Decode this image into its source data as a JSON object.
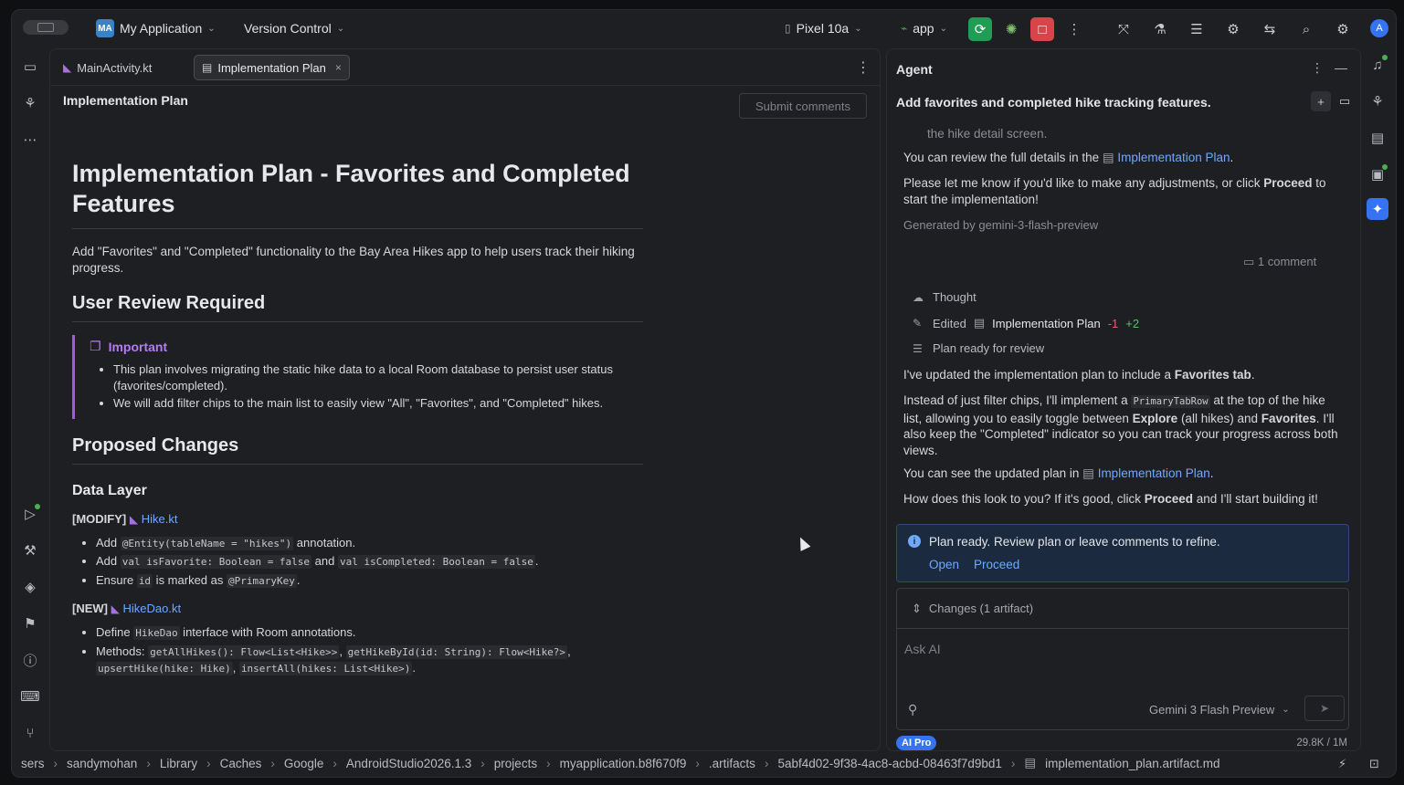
{
  "titlebar": {
    "project_badge": "MA",
    "project_name": "My Application",
    "vcs": "Version Control",
    "device": "Pixel 10a",
    "run_config": "app"
  },
  "avatar_letter": "A",
  "editor": {
    "tabs": [
      {
        "label": "MainActivity.kt"
      },
      {
        "label": "Implementation Plan"
      }
    ],
    "header": "Implementation Plan",
    "submit_label": "Submit comments",
    "doc": {
      "h1": "Implementation Plan - Favorites and Completed Features",
      "intro": "Add \"Favorites\" and \"Completed\" functionality to the Bay Area Hikes app to help users track their hiking progress.",
      "h2_review": "User Review Required",
      "callout_title": "Important",
      "callout_items": [
        "This plan involves migrating the static hike data to a local Room database to persist user status (favorites/completed).",
        "We will add filter chips to the main list to easily view \"All\", \"Favorites\", and \"Completed\" hikes."
      ],
      "h2_changes": "Proposed Changes",
      "h3_data": "Data Layer",
      "modify_tag": "[MODIFY]",
      "modify_file": "Hike.kt",
      "modify_items": {
        "add1_pre": "Add ",
        "add1_code": "@Entity(tableName = \"hikes\")",
        "add1_post": " annotation.",
        "add2_pre": "Add ",
        "add2_code1": "val isFavorite: Boolean = false",
        "add2_mid": " and ",
        "add2_code2": "val isCompleted: Boolean = false",
        "add2_post": ".",
        "ensure_pre": "Ensure ",
        "ensure_code1": "id",
        "ensure_mid": " is marked as ",
        "ensure_code2": "@PrimaryKey",
        "ensure_post": "."
      },
      "new_tag": "[NEW]",
      "new_file": "HikeDao.kt",
      "new_items": {
        "define_pre": "Define ",
        "define_code": "HikeDao",
        "define_post": " interface with Room annotations.",
        "methods_pre": "Methods: ",
        "m1": "getAllHikes(): Flow<List<Hike>>",
        "m2": "getHikeById(id: String): Flow<Hike?>",
        "m3": "upsertHike(hike: Hike)",
        "m4": "insertAll(hikes: List<Hike>)",
        "comma": ", ",
        "period": "."
      }
    }
  },
  "agent": {
    "title": "Agent",
    "subtitle": "Add favorites and completed hike tracking features.",
    "cut_line": "the hike detail screen.",
    "review_pre": "You can review the full details in the ",
    "review_link": "Implementation Plan",
    "review_post": ".",
    "proceed_pre": "Please let me know if you'd like to make any adjustments, or click ",
    "proceed_bold": "Proceed",
    "proceed_post": " to start the implementation!",
    "generated": "Generated by gemini-3-flash-preview",
    "comments": "1 comment",
    "thought": "Thought",
    "edited": "Edited",
    "edited_file": "Implementation Plan",
    "edited_minus": "-1",
    "edited_plus": "+2",
    "plan_ready_row": "Plan ready for review",
    "updated_pre": "I've updated the implementation plan to include a ",
    "updated_bold": "Favorites tab",
    "updated_post": ".",
    "instead_pre": "Instead of just filter chips, I'll implement a ",
    "instead_code": "PrimaryTabRow",
    "instead_mid": " at the top of the hike list, allowing you to easily toggle between ",
    "instead_b1": "Explore",
    "instead_mid2": " (all hikes) and ",
    "instead_b2": "Favorites",
    "instead_post": ". I'll also keep the \"Completed\" indicator so you can track your progress across both views.",
    "see_pre": "You can see the updated plan in ",
    "see_link": "Implementation Plan",
    "see_post": ".",
    "how_pre": "How does this look to you? If it's good, click ",
    "how_bold": "Proceed",
    "how_post": " and I'll start building it!",
    "plan_box_msg": "Plan ready. Review plan or leave comments to refine.",
    "plan_box_open": "Open",
    "plan_box_proceed": "Proceed",
    "changes": "Changes (1 artifact)",
    "ask_placeholder": "Ask AI",
    "model": "Gemini 3 Flash Preview",
    "badge": "AI Pro",
    "tokens": "29.8K / 1M"
  },
  "statusbar": {
    "crumbs": [
      "sers",
      "sandymohan",
      "Library",
      "Caches",
      "Google",
      "AndroidStudio2026.1.3",
      "projects",
      "myapplication.b8f670f9",
      ".artifacts",
      "5abf4d02-9f38-4ac8-acbd-08463f7d9bd1",
      "implementation_plan.artifact.md"
    ]
  },
  "colors": {
    "accent": "#3573f0",
    "callout_purple": "#9b5de5",
    "link": "#6ea8ff",
    "run_green": "#1f9d55",
    "stop_red": "#d9444b"
  }
}
